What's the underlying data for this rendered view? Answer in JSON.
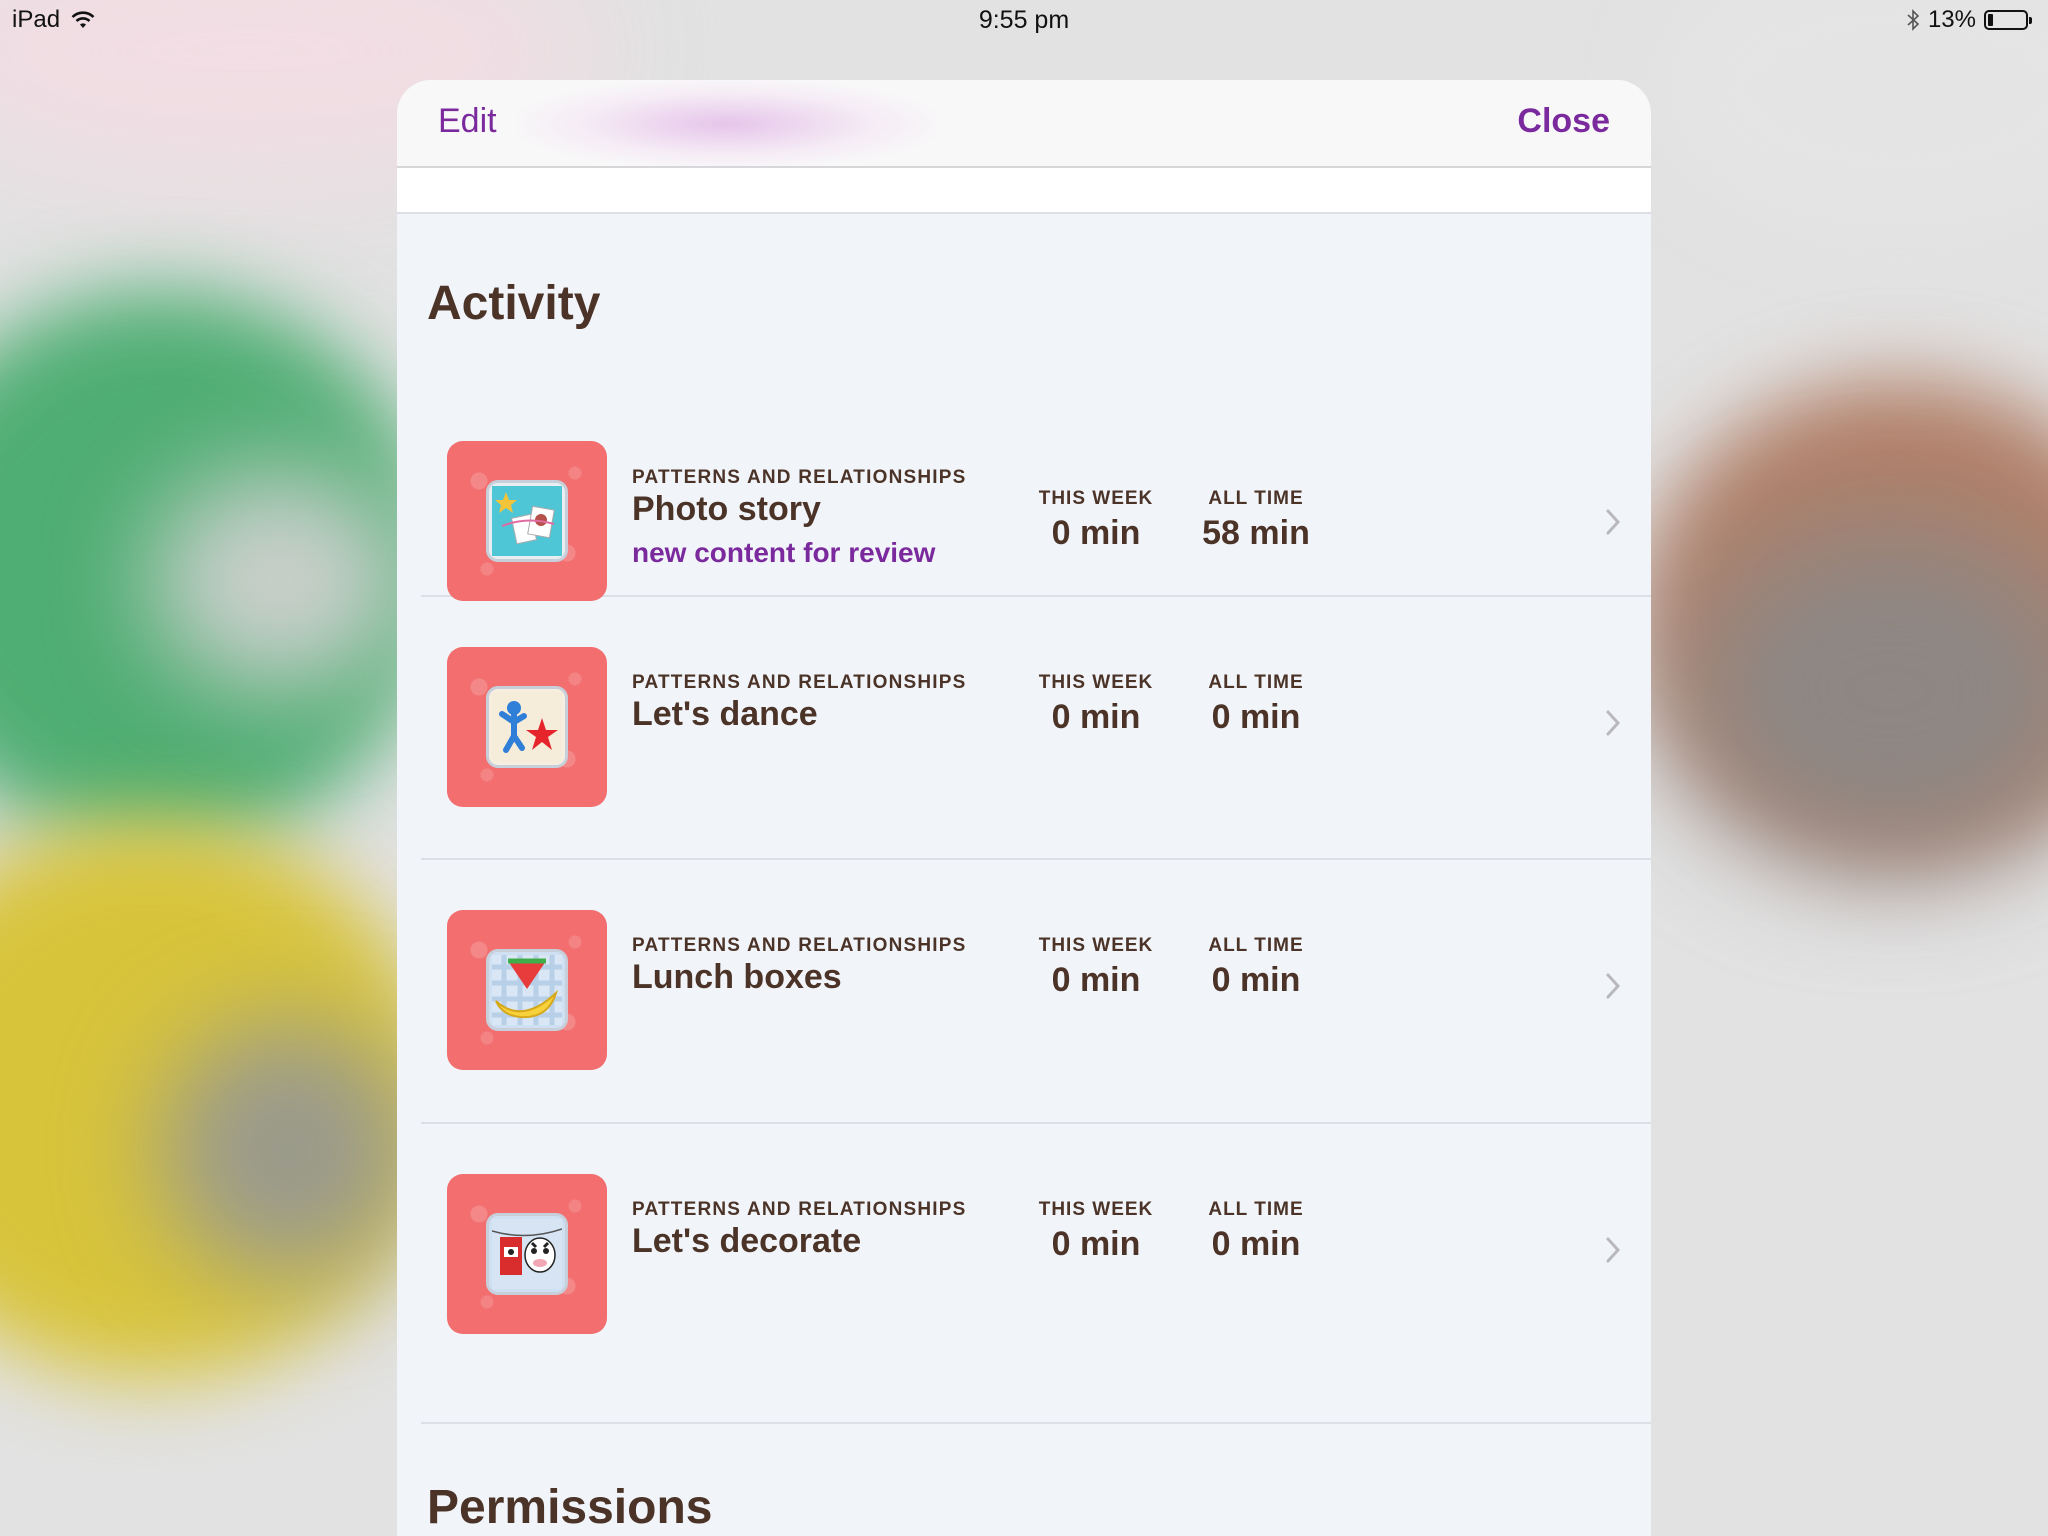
{
  "status_bar": {
    "device": "iPad",
    "time": "9:55 pm",
    "battery_percent": "13%",
    "battery_level": 0.13
  },
  "nav": {
    "edit_label": "Edit",
    "close_label": "Close"
  },
  "colors": {
    "accent": "#7b2a9e",
    "text": "#4b3328",
    "thumb_bg": "#f26e6f"
  },
  "activity": {
    "title": "Activity",
    "items": [
      {
        "category": "PATTERNS AND RELATIONSHIPS",
        "name": "Photo story",
        "note": "new content for review",
        "this_week_label": "THIS WEEK",
        "this_week_value": "0 min",
        "all_time_label": "ALL TIME",
        "all_time_value": "58 min",
        "icon": "photo-story-icon"
      },
      {
        "category": "PATTERNS AND RELATIONSHIPS",
        "name": "Let's dance",
        "this_week_label": "THIS WEEK",
        "this_week_value": "0 min",
        "all_time_label": "ALL TIME",
        "all_time_value": "0 min",
        "icon": "dance-icon"
      },
      {
        "category": "PATTERNS AND RELATIONSHIPS",
        "name": "Lunch boxes",
        "this_week_label": "THIS WEEK",
        "this_week_value": "0 min",
        "all_time_label": "ALL TIME",
        "all_time_value": "0 min",
        "icon": "lunch-box-icon"
      },
      {
        "category": "PATTERNS AND RELATIONSHIPS",
        "name": "Let's decorate",
        "this_week_label": "THIS WEEK",
        "this_week_value": "0 min",
        "all_time_label": "ALL TIME",
        "all_time_value": "0 min",
        "icon": "decorate-icon"
      }
    ]
  },
  "permissions": {
    "title": "Permissions"
  }
}
